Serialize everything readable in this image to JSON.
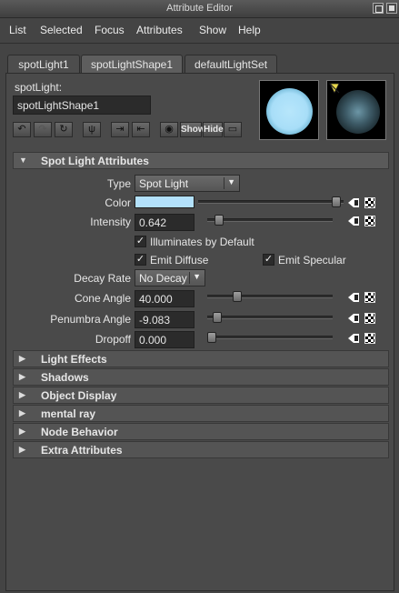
{
  "window": {
    "title": "Attribute Editor"
  },
  "menu": [
    "List",
    "Selected",
    "Focus",
    "Attributes",
    "Show",
    "Help"
  ],
  "tabs": [
    {
      "label": "spotLight1",
      "active": false
    },
    {
      "label": "spotLightShape1",
      "active": true
    },
    {
      "label": "defaultLightSet",
      "active": false
    }
  ],
  "node": {
    "type_label": "spotLight:",
    "name": "spotLightShape1"
  },
  "toolbar": {
    "show_label": "Show",
    "hide_label": "Hide"
  },
  "sections": {
    "spot_light": {
      "label": "Spot Light Attributes",
      "expanded": true
    },
    "collapsed": [
      "Light Effects",
      "Shadows",
      "Object Display",
      "mental ray",
      "Node Behavior",
      "Extra Attributes"
    ]
  },
  "attrs": {
    "type_label": "Type",
    "type_value": "Spot Light",
    "color_label": "Color",
    "color_value": "#b3e1fb",
    "color_level": 0.98,
    "intensity_label": "Intensity",
    "intensity_value": "0.642",
    "intensity_level": 0.064,
    "illuminates_label": "Illuminates by Default",
    "illuminates_checked": true,
    "emit_diffuse_label": "Emit Diffuse",
    "emit_diffuse_checked": true,
    "emit_specular_label": "Emit Specular",
    "emit_specular_checked": true,
    "decay_label": "Decay Rate",
    "decay_value": "No Decay",
    "cone_label": "Cone Angle",
    "cone_value": "40.000",
    "cone_level": 0.22,
    "penumbra_label": "Penumbra Angle",
    "penumbra_value": "-9.083",
    "penumbra_level": 0.05,
    "dropoff_label": "Dropoff",
    "dropoff_value": "0.000",
    "dropoff_level": 0.0
  },
  "colors": {
    "accent_swatch": "#b3e1fb",
    "background": "#444444"
  }
}
